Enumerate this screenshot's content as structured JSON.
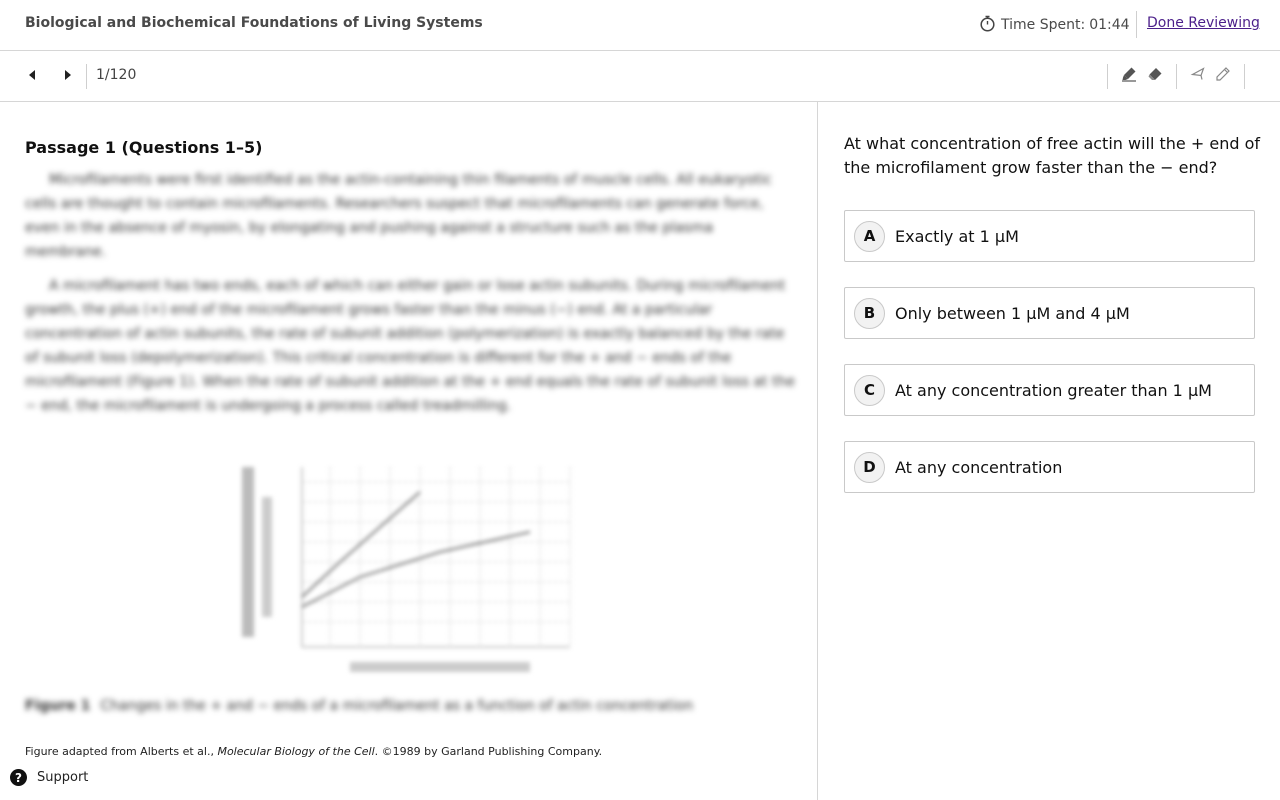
{
  "header": {
    "title": "Biological and Biochemical Foundations of Living Systems",
    "timer_label": "Time Spent:",
    "timer_value": "01:44",
    "done_label": "Done Reviewing",
    "icon": "stopwatch-icon"
  },
  "toolbar": {
    "counter": "1/120",
    "icons": [
      "prev-arrow-icon",
      "next-arrow-icon",
      "highlighter-icon",
      "eraser-icon",
      "strikethrough-icon",
      "pencil-icon"
    ]
  },
  "passage": {
    "title": "Passage 1 (Questions 1–5)",
    "paragraphs": [
      "Microfilaments were first identified as the actin-containing thin filaments of muscle cells. All eukaryotic cells are thought to contain microfilaments. Researchers suspect that microfilaments can generate force, even in the absence of myosin, by elongating and pushing against a structure such as the plasma membrane.",
      "A microfilament has two ends, each of which can either gain or lose actin subunits. During microfilament growth, the plus (+) end of the microfilament grows faster than the minus (−) end. At a particular concentration of actin subunits, the rate of subunit addition (polymerization) is exactly balanced by the rate of subunit loss (depolymerization). This critical concentration is different for the + and − ends of the microfilament (Figure 1). When the rate of subunit addition at the + end equals the rate of subunit loss at the − end, the microfilament is undergoing a process called treadmilling."
    ],
    "figure_label": "Figure 1",
    "figure_caption": "Changes in the + and − ends of a microfilament as a function of actin concentration",
    "credit_prefix": "Figure adapted from Alberts et al., ",
    "credit_title": "Molecular Biology of the Cell",
    "credit_suffix": ". ©1989 by Garland Publishing Company."
  },
  "question": {
    "stem": "At what concentration of free actin will the + end of the microfilament grow faster than the − end?",
    "choices": [
      {
        "letter": "A",
        "text": "Exactly at 1 μM"
      },
      {
        "letter": "B",
        "text": "Only between 1 μM and 4 μM"
      },
      {
        "letter": "C",
        "text": "At any concentration greater than 1 μM"
      },
      {
        "letter": "D",
        "text": "At any concentration"
      }
    ]
  },
  "support": {
    "label": "Support",
    "icon": "help-circle-icon"
  }
}
